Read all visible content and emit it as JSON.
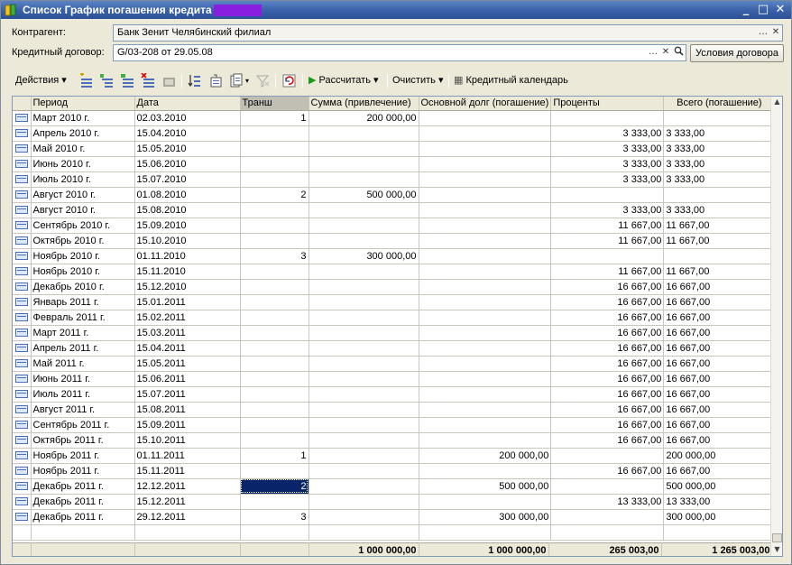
{
  "window": {
    "title": "Список График погашения кредита",
    "controls": {
      "minimize": "_",
      "maximize": "□",
      "close": "✕"
    }
  },
  "fields": {
    "counterparty": {
      "label": "Контрагент:",
      "value": "Банк Зенит Челябинский филиал"
    },
    "contract": {
      "label": "Кредитный договор:",
      "value": "G/03-208 от 29.05.08"
    },
    "contract_terms_button": "Условия договора"
  },
  "toolbar": {
    "actions": "Действия",
    "calculate": "Рассчитать",
    "clear": "Очистить",
    "credit_calendar": "Кредитный календарь"
  },
  "table": {
    "columns": [
      "",
      "Период",
      "Дата",
      "Транш",
      "Сумма (привлечение)",
      "Основной долг (погашение)",
      "Проценты",
      "Всего (погашение)"
    ],
    "rows": [
      [
        "Март 2010 г.",
        "02.03.2010",
        "1",
        "200 000,00",
        "",
        "",
        ""
      ],
      [
        "Апрель 2010 г.",
        "15.04.2010",
        "",
        "",
        "",
        "3 333,00",
        "3 333,00"
      ],
      [
        "Май 2010 г.",
        "15.05.2010",
        "",
        "",
        "",
        "3 333,00",
        "3 333,00"
      ],
      [
        "Июнь 2010 г.",
        "15.06.2010",
        "",
        "",
        "",
        "3 333,00",
        "3 333,00"
      ],
      [
        "Июль 2010 г.",
        "15.07.2010",
        "",
        "",
        "",
        "3 333,00",
        "3 333,00"
      ],
      [
        "Август 2010 г.",
        "01.08.2010",
        "2",
        "500 000,00",
        "",
        "",
        ""
      ],
      [
        "Август 2010 г.",
        "15.08.2010",
        "",
        "",
        "",
        "3 333,00",
        "3 333,00"
      ],
      [
        "Сентябрь 2010 г.",
        "15.09.2010",
        "",
        "",
        "",
        "11 667,00",
        "11 667,00"
      ],
      [
        "Октябрь 2010 г.",
        "15.10.2010",
        "",
        "",
        "",
        "11 667,00",
        "11 667,00"
      ],
      [
        "Ноябрь 2010 г.",
        "01.11.2010",
        "3",
        "300 000,00",
        "",
        "",
        ""
      ],
      [
        "Ноябрь 2010 г.",
        "15.11.2010",
        "",
        "",
        "",
        "11 667,00",
        "11 667,00"
      ],
      [
        "Декабрь 2010 г.",
        "15.12.2010",
        "",
        "",
        "",
        "16 667,00",
        "16 667,00"
      ],
      [
        "Январь 2011 г.",
        "15.01.2011",
        "",
        "",
        "",
        "16 667,00",
        "16 667,00"
      ],
      [
        "Февраль 2011 г.",
        "15.02.2011",
        "",
        "",
        "",
        "16 667,00",
        "16 667,00"
      ],
      [
        "Март 2011 г.",
        "15.03.2011",
        "",
        "",
        "",
        "16 667,00",
        "16 667,00"
      ],
      [
        "Апрель 2011 г.",
        "15.04.2011",
        "",
        "",
        "",
        "16 667,00",
        "16 667,00"
      ],
      [
        "Май 2011 г.",
        "15.05.2011",
        "",
        "",
        "",
        "16 667,00",
        "16 667,00"
      ],
      [
        "Июнь 2011 г.",
        "15.06.2011",
        "",
        "",
        "",
        "16 667,00",
        "16 667,00"
      ],
      [
        "Июль 2011 г.",
        "15.07.2011",
        "",
        "",
        "",
        "16 667,00",
        "16 667,00"
      ],
      [
        "Август 2011 г.",
        "15.08.2011",
        "",
        "",
        "",
        "16 667,00",
        "16 667,00"
      ],
      [
        "Сентябрь 2011 г.",
        "15.09.2011",
        "",
        "",
        "",
        "16 667,00",
        "16 667,00"
      ],
      [
        "Октябрь 2011 г.",
        "15.10.2011",
        "",
        "",
        "",
        "16 667,00",
        "16 667,00"
      ],
      [
        "Ноябрь 2011 г.",
        "01.11.2011",
        "1",
        "",
        "200 000,00",
        "",
        "200 000,00"
      ],
      [
        "Ноябрь 2011 г.",
        "15.11.2011",
        "",
        "",
        "",
        "16 667,00",
        "16 667,00"
      ],
      [
        "Декабрь 2011 г.",
        "12.12.2011",
        "2",
        "",
        "500 000,00",
        "",
        "500 000,00"
      ],
      [
        "Декабрь 2011 г.",
        "15.12.2011",
        "",
        "",
        "",
        "13 333,00",
        "13 333,00"
      ],
      [
        "Декабрь 2011 г.",
        "29.12.2011",
        "3",
        "",
        "300 000,00",
        "",
        "300 000,00"
      ]
    ],
    "selected_row": 24,
    "selected_col": 2,
    "totals": {
      "drawdown": "1 000 000,00",
      "principal": "1 000 000,00",
      "interest": "265 003,00",
      "total": "1 265 003,00"
    }
  }
}
